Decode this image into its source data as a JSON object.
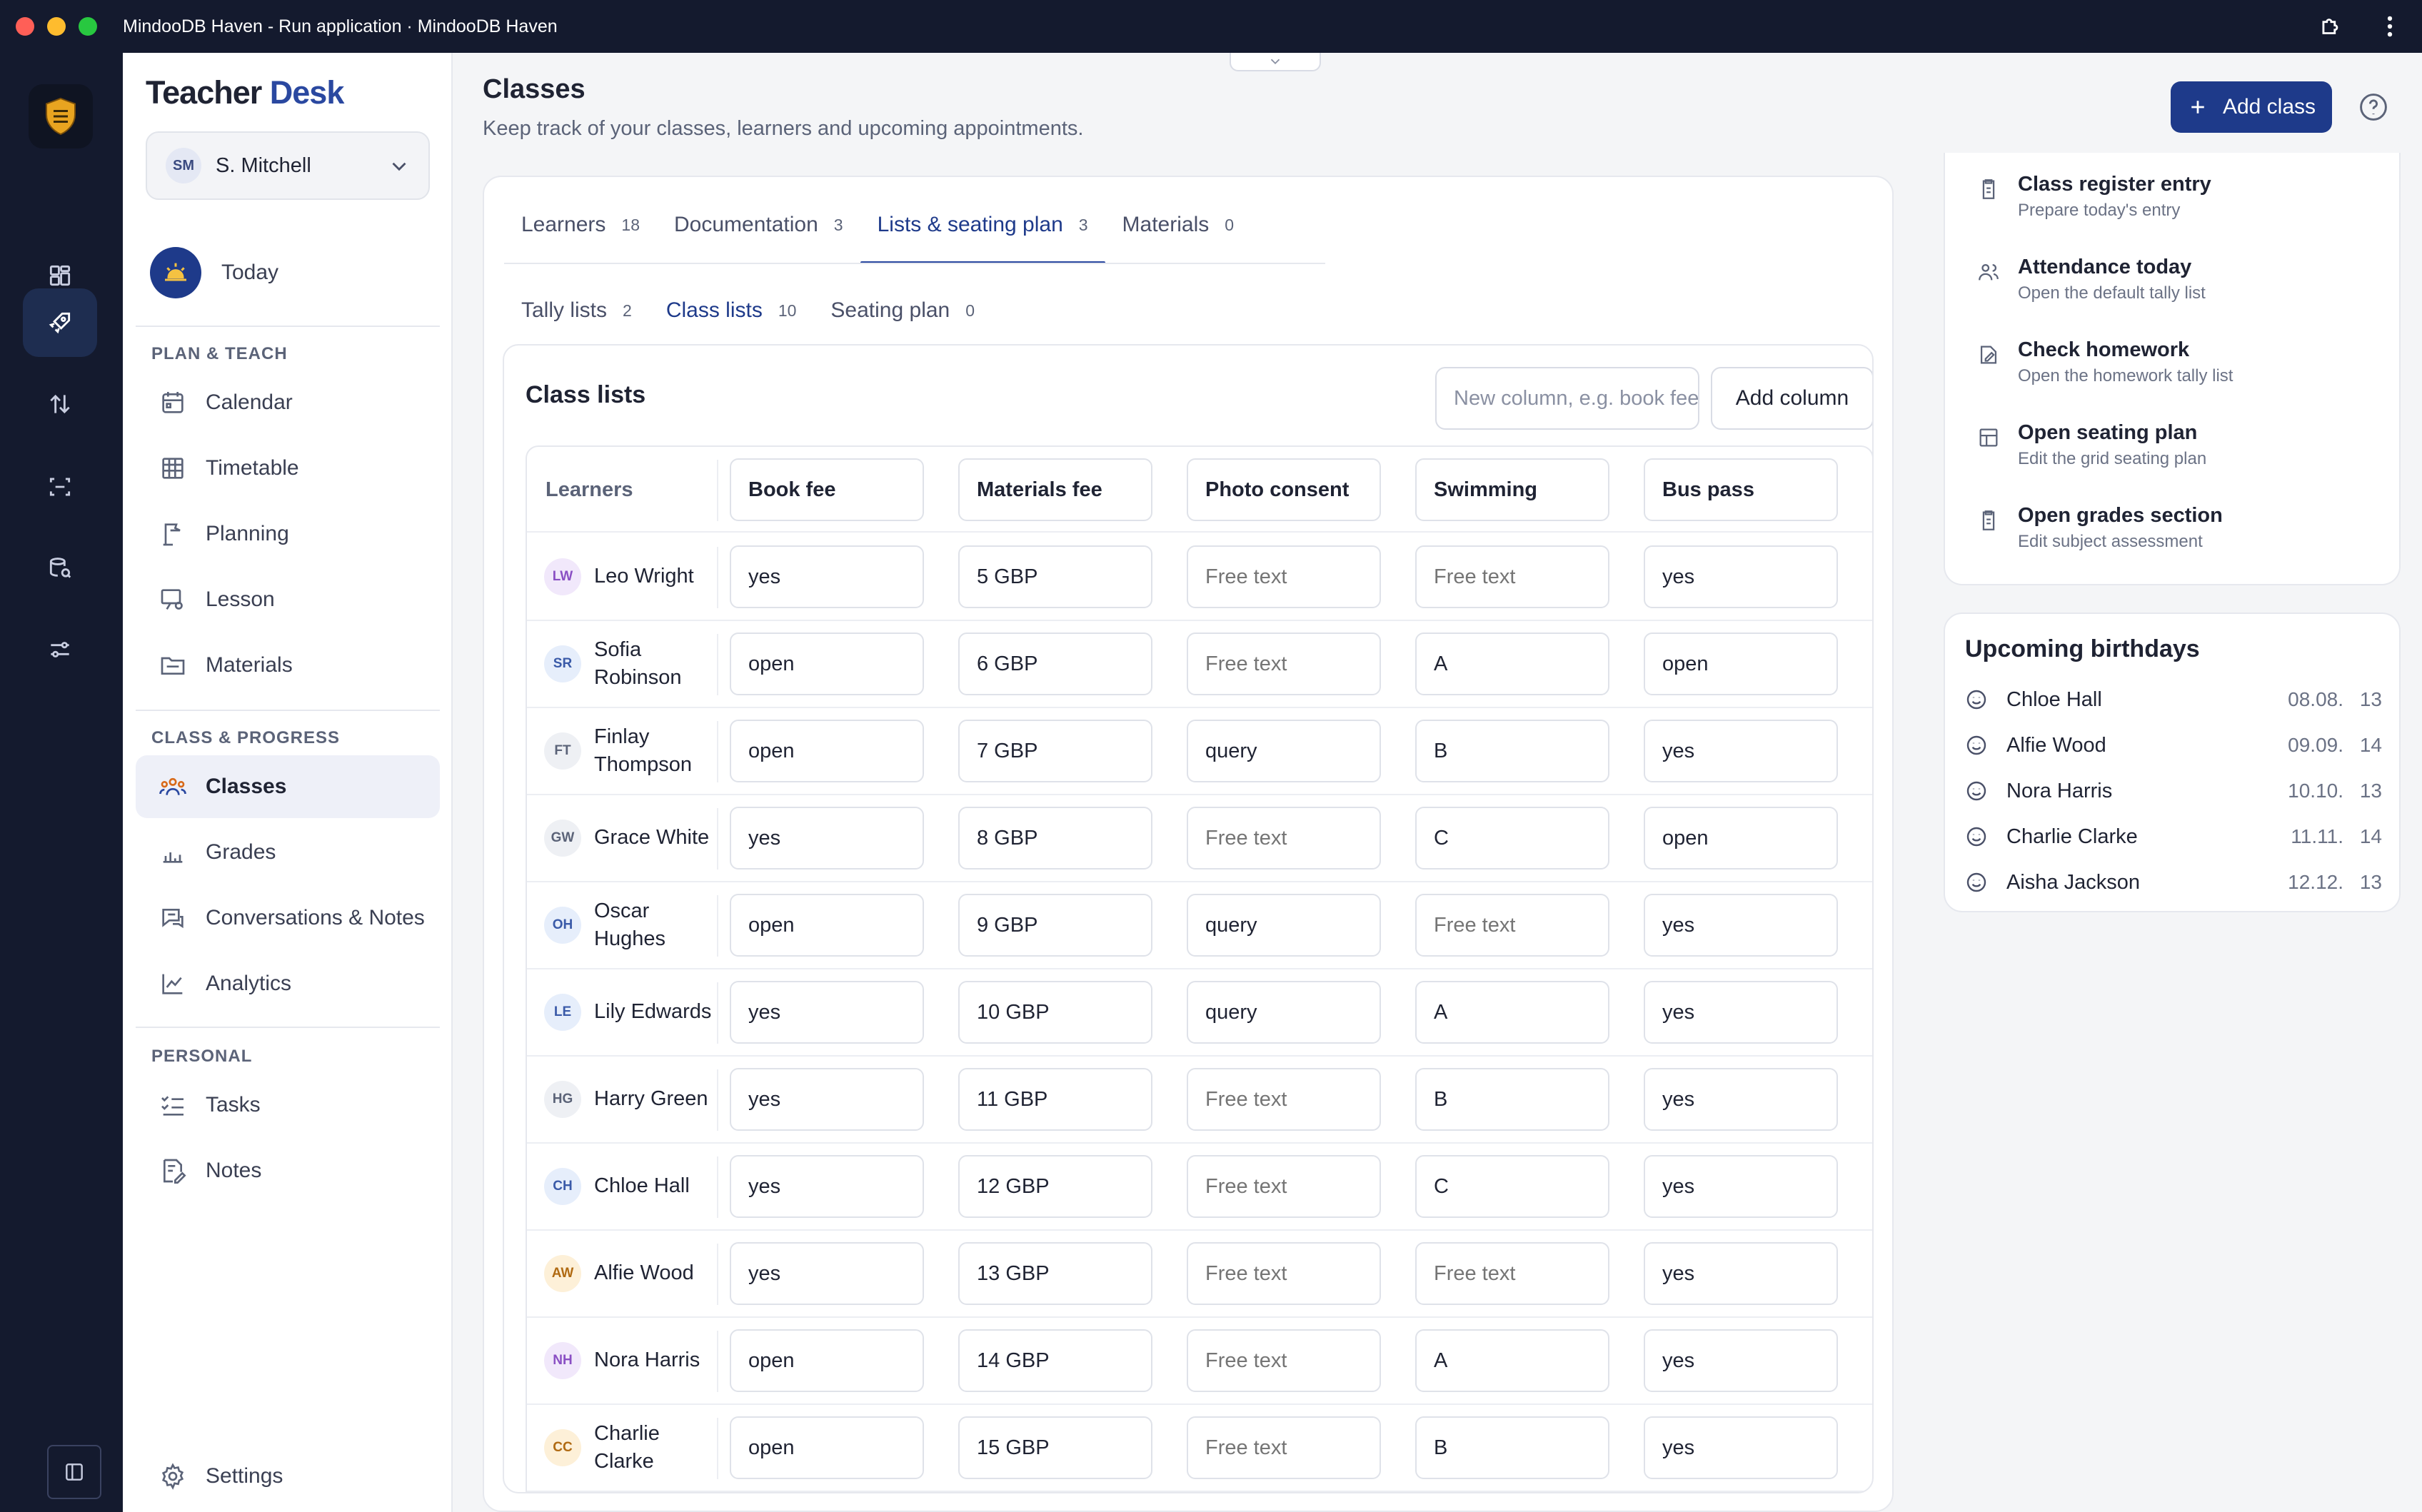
{
  "window": {
    "title": "MindooDB Haven - Run application · MindooDB Haven"
  },
  "sidebar": {
    "brand_first": "Teacher",
    "brand_second": "Desk",
    "user": {
      "initials": "SM",
      "name": "S. Mitchell"
    },
    "today_label": "Today",
    "sections": [
      {
        "label": "PLAN & TEACH",
        "items": [
          "Calendar",
          "Timetable",
          "Planning",
          "Lesson",
          "Materials"
        ]
      },
      {
        "label": "CLASS & PROGRESS",
        "items": [
          "Classes",
          "Grades",
          "Conversations & Notes",
          "Analytics"
        ]
      },
      {
        "label": "PERSONAL",
        "items": [
          "Tasks",
          "Notes"
        ]
      }
    ],
    "settings_label": "Settings"
  },
  "header": {
    "title": "Classes",
    "subtitle": "Keep track of your classes, learners and upcoming appointments.",
    "add_class_label": "Add class"
  },
  "tabs": [
    {
      "label": "Learners",
      "count": "18"
    },
    {
      "label": "Documentation",
      "count": "3"
    },
    {
      "label": "Lists & seating plan",
      "count": "3",
      "active": true
    },
    {
      "label": "Materials",
      "count": "0"
    }
  ],
  "subtabs": [
    {
      "label": "Tally lists",
      "count": "2"
    },
    {
      "label": "Class lists",
      "count": "10",
      "active": true
    },
    {
      "label": "Seating plan",
      "count": "0"
    }
  ],
  "class_lists": {
    "title": "Class lists",
    "new_column_placeholder": "New column, e.g. book fee",
    "add_column_label": "Add column",
    "learners_header": "Learners",
    "columns": [
      "Book fee",
      "Materials fee",
      "Photo consent",
      "Swimming",
      "Bus pass"
    ],
    "placeholder": "Free text",
    "rows": [
      {
        "initials": "LW",
        "name": "Leo Wright",
        "avatar_bg": "#f1e8fb",
        "avatar_fg": "#8a4fc4",
        "cells": [
          "yes",
          "5 GBP",
          "",
          "",
          "yes"
        ]
      },
      {
        "initials": "SR",
        "name": "Sofia Robinson",
        "avatar_bg": "#e6eefb",
        "avatar_fg": "#3a5aa8",
        "cells": [
          "open",
          "6 GBP",
          "",
          "A",
          "open"
        ]
      },
      {
        "initials": "FT",
        "name": "Finlay Thompson",
        "avatar_bg": "#eef0f4",
        "avatar_fg": "#5b6378",
        "cells": [
          "open",
          "7 GBP",
          "query",
          "B",
          "yes"
        ]
      },
      {
        "initials": "GW",
        "name": "Grace White",
        "avatar_bg": "#eef0f4",
        "avatar_fg": "#5b6378",
        "cells": [
          "yes",
          "8 GBP",
          "",
          "C",
          "open"
        ]
      },
      {
        "initials": "OH",
        "name": "Oscar Hughes",
        "avatar_bg": "#e6eefb",
        "avatar_fg": "#3a5aa8",
        "cells": [
          "open",
          "9 GBP",
          "query",
          "",
          "yes"
        ]
      },
      {
        "initials": "LE",
        "name": "Lily Edwards",
        "avatar_bg": "#e6eefb",
        "avatar_fg": "#3a5aa8",
        "cells": [
          "yes",
          "10 GBP",
          "query",
          "A",
          "yes"
        ]
      },
      {
        "initials": "HG",
        "name": "Harry Green",
        "avatar_bg": "#eef0f4",
        "avatar_fg": "#5b6378",
        "cells": [
          "yes",
          "11 GBP",
          "",
          "B",
          "yes"
        ]
      },
      {
        "initials": "CH",
        "name": "Chloe Hall",
        "avatar_bg": "#e6eefb",
        "avatar_fg": "#3a5aa8",
        "cells": [
          "yes",
          "12 GBP",
          "",
          "C",
          "yes"
        ]
      },
      {
        "initials": "AW",
        "name": "Alfie Wood",
        "avatar_bg": "#fdf0d8",
        "avatar_fg": "#b06a12",
        "cells": [
          "yes",
          "13 GBP",
          "",
          "",
          "yes"
        ]
      },
      {
        "initials": "NH",
        "name": "Nora Harris",
        "avatar_bg": "#f1e8fb",
        "avatar_fg": "#8a4fc4",
        "cells": [
          "open",
          "14 GBP",
          "",
          "A",
          "yes"
        ]
      },
      {
        "initials": "CC",
        "name": "Charlie Clarke",
        "avatar_bg": "#fdf0d8",
        "avatar_fg": "#b06a12",
        "cells": [
          "open",
          "15 GBP",
          "",
          "B",
          "yes"
        ]
      }
    ]
  },
  "quick_actions": [
    {
      "title": "Class register entry",
      "subtitle": "Prepare today's entry",
      "icon": "clipboard-icon"
    },
    {
      "title": "Attendance today",
      "subtitle": "Open the default tally list",
      "icon": "users-icon"
    },
    {
      "title": "Check homework",
      "subtitle": "Open the homework tally list",
      "icon": "edit-icon"
    },
    {
      "title": "Open seating plan",
      "subtitle": "Edit the grid seating plan",
      "icon": "grid-icon"
    },
    {
      "title": "Open grades section",
      "subtitle": "Edit subject assessment",
      "icon": "clipboard-icon"
    }
  ],
  "birthdays": {
    "title": "Upcoming birthdays",
    "items": [
      {
        "name": "Chloe Hall",
        "date": "08.08.",
        "age": "13"
      },
      {
        "name": "Alfie Wood",
        "date": "09.09.",
        "age": "14"
      },
      {
        "name": "Nora Harris",
        "date": "10.10.",
        "age": "13"
      },
      {
        "name": "Charlie Clarke",
        "date": "11.11.",
        "age": "14"
      },
      {
        "name": "Aisha Jackson",
        "date": "12.12.",
        "age": "13"
      }
    ]
  },
  "colors": {
    "accent": "#1e3a8a",
    "rail": "#141a2e"
  }
}
